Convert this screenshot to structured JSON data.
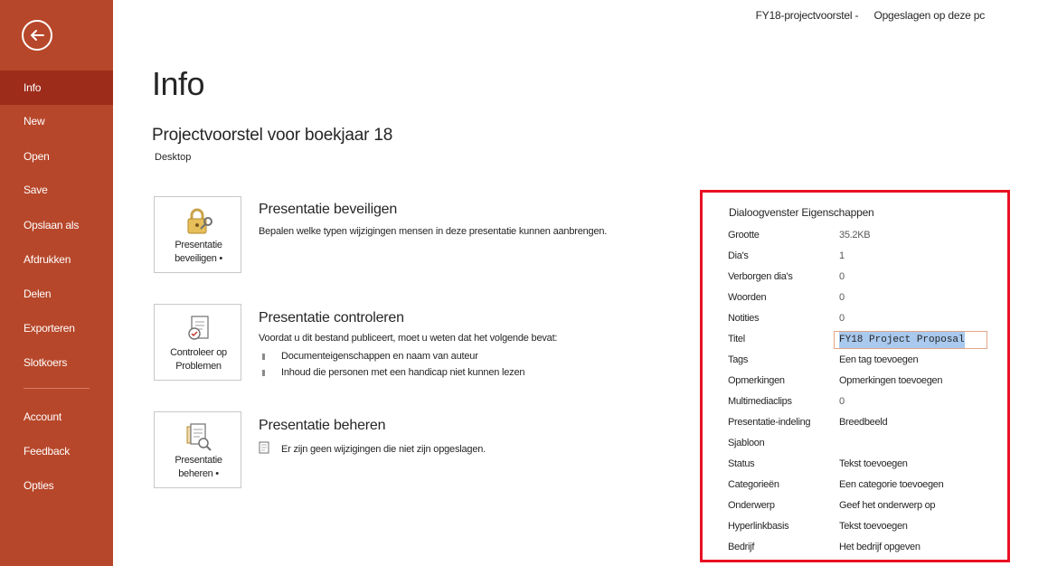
{
  "topbar": {
    "filename": "FY18-projectvoorstel -",
    "save_status": "Opgeslagen op deze pc"
  },
  "sidebar": {
    "items": [
      {
        "label": "Info",
        "active": true
      },
      {
        "label": "New"
      },
      {
        "label": "Open"
      },
      {
        "label": "Save"
      },
      {
        "label": "Opslaan als"
      },
      {
        "label": "Afdrukken"
      },
      {
        "label": "Delen"
      },
      {
        "label": "Exporteren"
      },
      {
        "label": "Slotkoers"
      },
      {
        "label": "Account"
      },
      {
        "label": "Feedback"
      },
      {
        "label": "Opties"
      }
    ]
  },
  "page": {
    "title": "Info",
    "doc_title": "Projectvoorstel voor boekjaar 18",
    "doc_location": "Desktop"
  },
  "sections": {
    "protect": {
      "tile_line1": "Presentatie",
      "tile_line2": "beveiligen •",
      "title": "Presentatie beveiligen",
      "desc": "Bepalen welke typen wijzigingen mensen in deze presentatie kunnen aanbrengen."
    },
    "inspect": {
      "tile_line1": "Controleer op",
      "tile_line2": "Problemen",
      "title": "Presentatie controleren",
      "desc": "Voordat u dit bestand publiceert, moet u weten dat het volgende bevat:",
      "bullets": [
        "Documenteigenschappen en naam van auteur",
        "Inhoud die personen met een handicap niet kunnen lezen"
      ]
    },
    "manage": {
      "tile_line1": "Presentatie",
      "tile_line2": "beheren •",
      "title": "Presentatie beheren",
      "desc": "Er zijn geen wijzigingen die niet zijn opgeslagen."
    }
  },
  "properties": {
    "header": "Dialoogvenster Eigenschappen",
    "rows": [
      {
        "label": "Grootte",
        "value": "35.2KB"
      },
      {
        "label": "Dia's",
        "value": "1"
      },
      {
        "label": "Verborgen dia's",
        "value": "0"
      },
      {
        "label": "Woorden",
        "value": "0"
      },
      {
        "label": "Notities",
        "value": "0"
      },
      {
        "label": "Titel",
        "value": "FY18 Project Proposal"
      },
      {
        "label": "Tags",
        "value": "Een tag toevoegen"
      },
      {
        "label": "Opmerkingen",
        "value": "Opmerkingen toevoegen"
      },
      {
        "label": "Multimediaclips",
        "value": "0"
      },
      {
        "label": "Presentatie-indeling",
        "value": "Breedbeeld"
      },
      {
        "label": "Sjabloon",
        "value": ""
      },
      {
        "label": "Status",
        "value": "Tekst toevoegen"
      },
      {
        "label": "Categorieën",
        "value": "Een categorie toevoegen"
      },
      {
        "label": "Onderwerp",
        "value": "Geef het onderwerp op"
      },
      {
        "label": "Hyperlinkbasis",
        "value": "Tekst toevoegen"
      },
      {
        "label": "Bedrijf",
        "value": "Het bedrijf opgeven"
      }
    ]
  },
  "colors": {
    "sidebar": "#b7472a",
    "sidebar_active": "#9e2c1a",
    "highlight_border": "#e81123"
  }
}
